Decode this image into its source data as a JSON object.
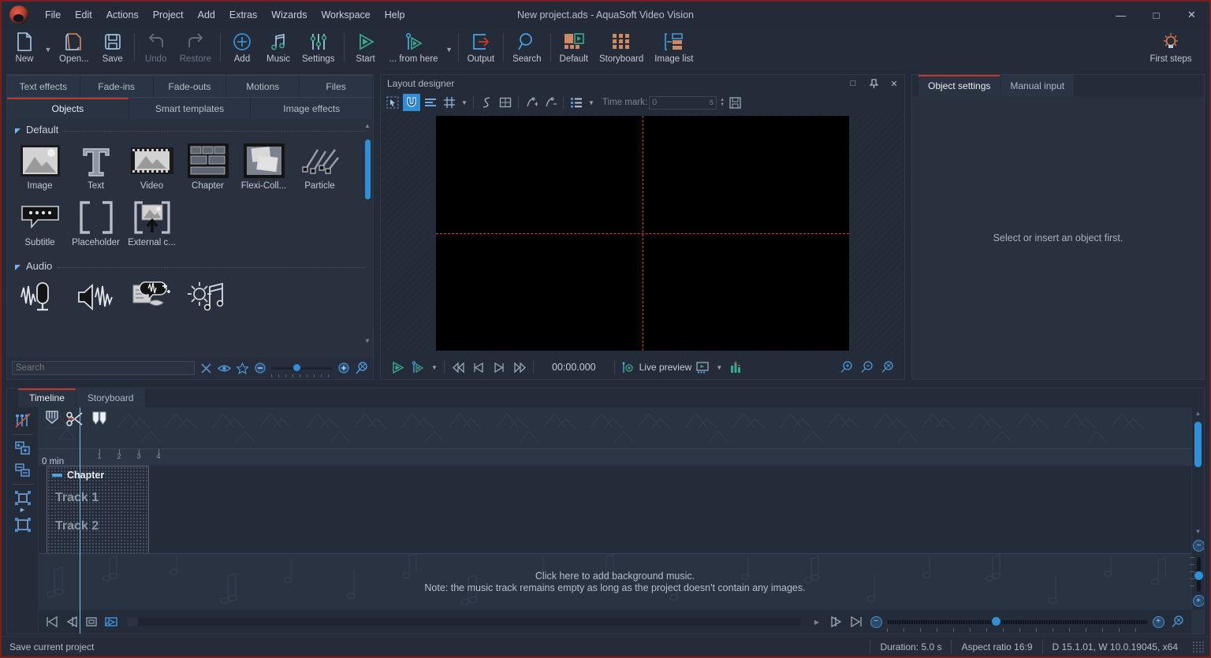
{
  "window": {
    "title": "New project.ads - AquaSoft Video Vision",
    "minimize": "—",
    "maximize": "□",
    "close": "✕"
  },
  "menubar": {
    "items": [
      {
        "label": "File"
      },
      {
        "label": "Edit"
      },
      {
        "label": "Actions"
      },
      {
        "label": "Project"
      },
      {
        "label": "Add"
      },
      {
        "label": "Extras"
      },
      {
        "label": "Wizards"
      },
      {
        "label": "Workspace"
      },
      {
        "label": "Help"
      }
    ]
  },
  "toolbar": {
    "items": [
      {
        "label": "New",
        "icon": "new-document-icon",
        "disabled": false
      },
      {
        "label": "Open...",
        "icon": "open-folder-icon",
        "disabled": false
      },
      {
        "label": "Save",
        "icon": "floppy-disk-icon",
        "disabled": false
      },
      {
        "label": "Undo",
        "icon": "undo-arrow-icon",
        "disabled": true
      },
      {
        "label": "Restore",
        "icon": "redo-arrow-icon",
        "disabled": true
      },
      {
        "label": "Add",
        "icon": "plus-circle-icon",
        "disabled": false
      },
      {
        "label": "Music",
        "icon": "music-note-icon",
        "disabled": false
      },
      {
        "label": "Settings",
        "icon": "sliders-icon",
        "disabled": false
      },
      {
        "label": "Start",
        "icon": "play-triangle-icon",
        "disabled": false
      },
      {
        "label": "... from here",
        "icon": "play-from-here-icon",
        "disabled": false
      },
      {
        "label": "Output",
        "icon": "export-arrow-icon",
        "disabled": false
      },
      {
        "label": "Search",
        "icon": "magnifier-icon",
        "disabled": false
      },
      {
        "label": "Default",
        "icon": "layout-default-icon",
        "disabled": false
      },
      {
        "label": "Storyboard",
        "icon": "grid-squares-icon",
        "disabled": false
      },
      {
        "label": "Image list",
        "icon": "image-list-icon",
        "disabled": false
      }
    ],
    "first_steps": {
      "label": "First steps",
      "icon": "lightbulb-icon"
    }
  },
  "left_panel": {
    "tabs_row1": [
      {
        "label": "Text effects",
        "active": false
      },
      {
        "label": "Fade-ins",
        "active": false
      },
      {
        "label": "Fade-outs",
        "active": false
      },
      {
        "label": "Motions",
        "active": false
      },
      {
        "label": "Files",
        "active": false
      }
    ],
    "tabs_row2": [
      {
        "label": "Objects",
        "active": true
      },
      {
        "label": "Smart templates",
        "active": false
      },
      {
        "label": "Image effects",
        "active": false
      }
    ],
    "groups": [
      {
        "name": "Default",
        "rows": [
          [
            {
              "label": "Image",
              "icon": "image-thumbnail-icon"
            },
            {
              "label": "Text",
              "icon": "text-T-icon"
            },
            {
              "label": "Video",
              "icon": "filmstrip-icon"
            },
            {
              "label": "Chapter",
              "icon": "chapter-grid-icon"
            },
            {
              "label": "Flexi-Coll...",
              "icon": "flexi-collage-icon"
            },
            {
              "label": "Particle",
              "icon": "particle-icon"
            }
          ],
          [
            {
              "label": "Subtitle",
              "icon": "subtitle-balloon-icon"
            },
            {
              "label": "Placeholder",
              "icon": "placeholder-brackets-icon"
            },
            {
              "label": "External c...",
              "icon": "external-content-icon"
            }
          ]
        ]
      },
      {
        "name": "Audio",
        "rows": [
          [
            {
              "label": "",
              "icon": "microphone-waveform-icon"
            },
            {
              "label": "",
              "icon": "speaker-waveform-icon"
            },
            {
              "label": "",
              "icon": "speech-to-text-icon"
            },
            {
              "label": "",
              "icon": "sound-effects-icon"
            }
          ]
        ]
      }
    ],
    "search": {
      "placeholder": "Search",
      "value": "",
      "clear_icon": "clear-x-icon",
      "eye_icon": "eye-preview-icon",
      "star_icon": "favorite-star-icon",
      "zoom_out_icon": "zoom-minus-icon",
      "zoom_in_icon": "zoom-plus-icon",
      "reset_zoom_icon": "zoom-reset-icon"
    }
  },
  "layout_designer": {
    "title": "Layout designer",
    "header_buttons": [
      {
        "icon": "restore-window-icon",
        "label": "□"
      },
      {
        "icon": "pin-icon",
        "label": "⚲"
      },
      {
        "icon": "close-icon",
        "label": "✕"
      }
    ],
    "toolbar": [
      {
        "icon": "select-marquee-icon",
        "active": false
      },
      {
        "icon": "magnet-snap-icon",
        "active": true
      },
      {
        "icon": "align-lines-icon",
        "active": false
      },
      {
        "icon": "grid-hash-icon",
        "active": false
      },
      {
        "icon": "grid-dropdown-caret",
        "active": false
      },
      {
        "icon": "motion-path-icon",
        "active": false
      },
      {
        "icon": "frame-icon",
        "active": false
      },
      {
        "icon": "add-keyframe-icon",
        "active": false
      },
      {
        "icon": "remove-keyframe-icon",
        "active": false
      },
      {
        "icon": "list-view-icon",
        "active": false
      },
      {
        "icon": "list-dropdown-caret",
        "active": false
      }
    ],
    "time_mark_label": "Time mark:",
    "time_mark_value": "0",
    "time_mark_unit": "s",
    "save_icon": "save-layout-icon"
  },
  "transport": {
    "buttons": [
      {
        "icon": "play-icon"
      },
      {
        "icon": "play-from-here-icon"
      },
      {
        "icon": "dropdown-caret-icon"
      },
      {
        "icon": "rewind-icon"
      },
      {
        "icon": "previous-frame-icon"
      },
      {
        "icon": "next-frame-icon"
      },
      {
        "icon": "fast-forward-icon"
      }
    ],
    "timecode": "00:00.000",
    "live_preview_label": "Live preview",
    "live_preview_icon": "live-preview-icon",
    "monitor_icon": "monitor-output-icon",
    "monitor_caret": "dropdown-caret-icon",
    "levels_icon": "audio-levels-icon",
    "zoom_buttons": [
      {
        "icon": "zoom-in-icon"
      },
      {
        "icon": "zoom-out-icon"
      },
      {
        "icon": "zoom-fit-icon"
      }
    ]
  },
  "right_panel": {
    "tabs": [
      {
        "label": "Object settings",
        "active": true
      },
      {
        "label": "Manual input",
        "active": false
      }
    ],
    "empty_message": "Select or insert an object first."
  },
  "timeline": {
    "tabs": [
      {
        "label": "Timeline",
        "active": true
      },
      {
        "label": "Storyboard",
        "active": false
      }
    ],
    "sidebar_buttons": [
      {
        "icon": "hide-tracks-icon"
      },
      {
        "icon": "add-track-icon"
      },
      {
        "icon": "duplicate-track-icon"
      },
      {
        "icon": "fit-selection-icon"
      },
      {
        "icon": "fit-all-icon"
      }
    ],
    "tools": [
      {
        "icon": "playhead-marker-icon"
      },
      {
        "icon": "scissors-cut-icon"
      },
      {
        "icon": "split-marker-icon"
      }
    ],
    "ruler": {
      "unit_label": "0 min",
      "ticks": [
        "1",
        "2",
        "3",
        "4"
      ]
    },
    "chapter": {
      "title": "Chapter",
      "tracks": [
        {
          "label": "Track 1"
        },
        {
          "label": "Track 2"
        }
      ]
    },
    "music_track": {
      "line1": "Click here to add background music.",
      "line2": "Note: the music track remains empty as long as the project doesn't contain any images."
    },
    "hscroll_buttons": [
      {
        "icon": "jump-to-start-icon"
      },
      {
        "icon": "step-back-icon"
      },
      {
        "icon": "fit-timeline-icon"
      },
      {
        "icon": "preview-here-icon"
      }
    ],
    "hscroll_right_buttons": [
      {
        "icon": "step-forward-icon"
      },
      {
        "icon": "jump-to-end-icon"
      }
    ],
    "zoom": {
      "minus_icon": "zoom-minus-icon",
      "plus_icon": "zoom-plus-icon",
      "reset_icon": "zoom-reset-icon"
    }
  },
  "statusbar": {
    "hint": "Save current project",
    "duration": "Duration: 5.0 s",
    "aspect_ratio": "Aspect ratio 16:9",
    "system": "D 15.1.01, W 10.0.19045, x64"
  },
  "colors": {
    "accent_blue": "#2f8fd8",
    "accent_red": "#c0392b",
    "window_bg": "#242c3a",
    "panel_bg": "#29313f",
    "text": "#c6ccd6",
    "teal": "#3aa98c",
    "orange": "#d08a63"
  }
}
